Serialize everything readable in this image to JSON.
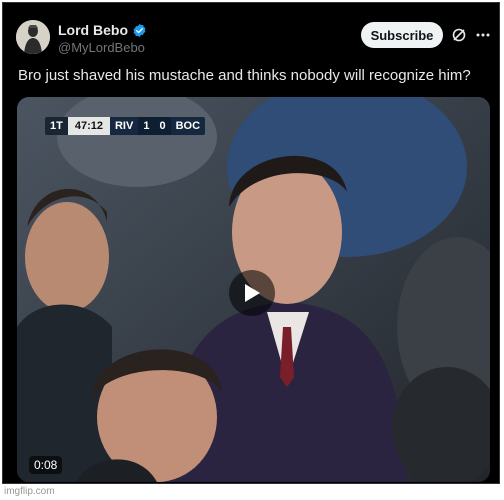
{
  "post": {
    "author_name": "Lord Bebo",
    "author_handle": "@MyLordBebo",
    "subscribe_label": "Subscribe",
    "text": "Bro just shaved his mustache and thinks nobody will recognize him?",
    "verified": true
  },
  "video": {
    "duration": "0:08",
    "scoreboard": {
      "period": "1T",
      "clock": "47:12",
      "home": "RIV",
      "home_score": "1",
      "away_score": "0",
      "away": "BOC"
    }
  },
  "watermark": "imgflip.com",
  "icons": {
    "verified": "verified-badge-icon",
    "grok": "grok-icon",
    "more": "more-icon",
    "play": "play-icon"
  },
  "colors": {
    "background": "#000000",
    "text_primary": "#e7e9ea",
    "text_secondary": "#71767b",
    "verified_blue": "#1d9bf0",
    "subscribe_bg": "#eff3f4"
  }
}
